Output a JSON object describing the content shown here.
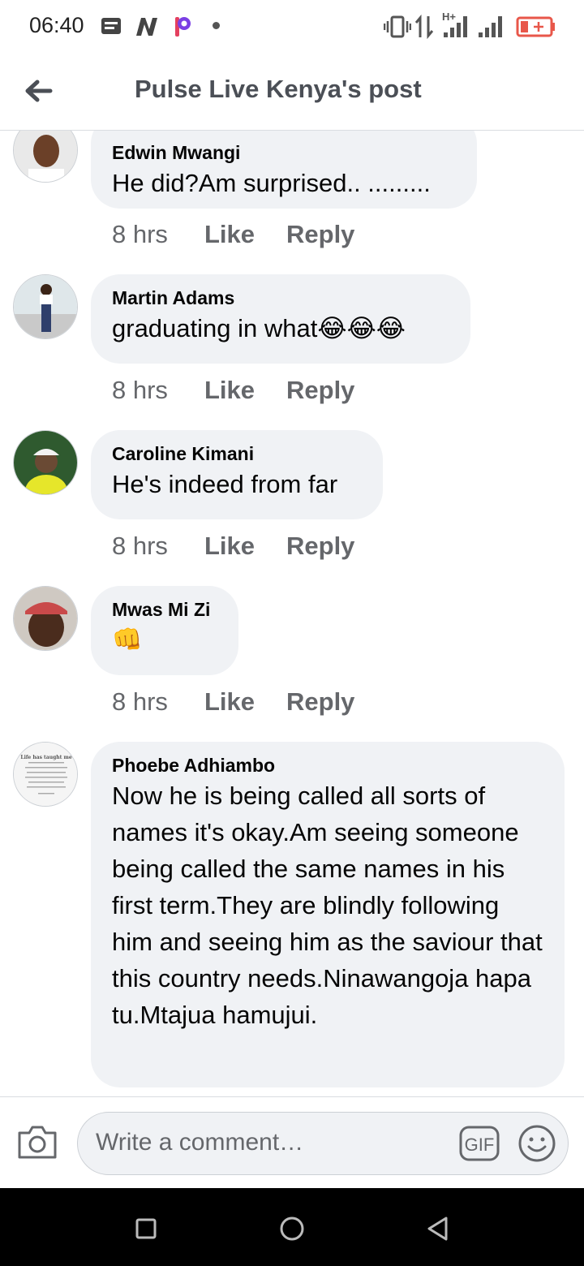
{
  "status_bar": {
    "time": "06:40",
    "network_label": "H+"
  },
  "header": {
    "title": "Pulse Live Kenya's post"
  },
  "comments": [
    {
      "author": "Edwin Mwangi",
      "text": "He did?Am surprised.. .........",
      "time": "8 hrs",
      "like": "Like",
      "reply": "Reply"
    },
    {
      "author": "Martin Adams",
      "text": "graduating in what😂😂😂",
      "time": "8 hrs",
      "like": "Like",
      "reply": "Reply"
    },
    {
      "author": "Caroline Kimani",
      "text": "He's indeed from far",
      "time": "8 hrs",
      "like": "Like",
      "reply": "Reply"
    },
    {
      "author": "Mwas Mi Zi",
      "text": "👊",
      "time": "8 hrs",
      "like": "Like",
      "reply": "Reply"
    },
    {
      "author": "Phoebe Adhiambo",
      "text": "Now he is being called all sorts of names it's okay.Am seeing someone being called the same names in his first term.They are blindly following him and seeing him as the saviour that this country needs.Ninawangoja hapa tu.Mtajua hamujui.",
      "avatar_caption": "Life has taught me"
    }
  ],
  "composer": {
    "placeholder": "Write a comment…",
    "gif_label": "GIF"
  },
  "colors": {
    "bubble": "#f0f2f5",
    "meta": "#65676b",
    "header_text": "#4b4f56",
    "battery": "#e8574a"
  },
  "icons": [
    "back-arrow-icon",
    "camera-icon",
    "gif-icon",
    "emoji-icon",
    "nav-square-icon",
    "nav-circle-icon",
    "nav-back-triangle-icon"
  ]
}
